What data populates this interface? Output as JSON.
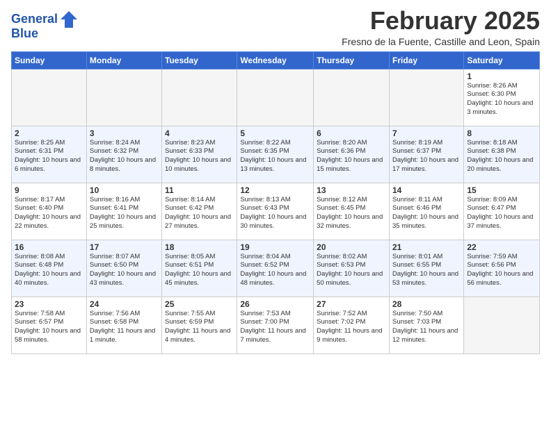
{
  "header": {
    "logo_line1": "General",
    "logo_line2": "Blue",
    "month": "February 2025",
    "location": "Fresno de la Fuente, Castille and Leon, Spain"
  },
  "weekdays": [
    "Sunday",
    "Monday",
    "Tuesday",
    "Wednesday",
    "Thursday",
    "Friday",
    "Saturday"
  ],
  "weeks": [
    [
      {
        "day": "",
        "info": ""
      },
      {
        "day": "",
        "info": ""
      },
      {
        "day": "",
        "info": ""
      },
      {
        "day": "",
        "info": ""
      },
      {
        "day": "",
        "info": ""
      },
      {
        "day": "",
        "info": ""
      },
      {
        "day": "1",
        "info": "Sunrise: 8:26 AM\nSunset: 6:30 PM\nDaylight: 10 hours\nand 3 minutes."
      }
    ],
    [
      {
        "day": "2",
        "info": "Sunrise: 8:25 AM\nSunset: 6:31 PM\nDaylight: 10 hours\nand 6 minutes."
      },
      {
        "day": "3",
        "info": "Sunrise: 8:24 AM\nSunset: 6:32 PM\nDaylight: 10 hours\nand 8 minutes."
      },
      {
        "day": "4",
        "info": "Sunrise: 8:23 AM\nSunset: 6:33 PM\nDaylight: 10 hours\nand 10 minutes."
      },
      {
        "day": "5",
        "info": "Sunrise: 8:22 AM\nSunset: 6:35 PM\nDaylight: 10 hours\nand 13 minutes."
      },
      {
        "day": "6",
        "info": "Sunrise: 8:20 AM\nSunset: 6:36 PM\nDaylight: 10 hours\nand 15 minutes."
      },
      {
        "day": "7",
        "info": "Sunrise: 8:19 AM\nSunset: 6:37 PM\nDaylight: 10 hours\nand 17 minutes."
      },
      {
        "day": "8",
        "info": "Sunrise: 8:18 AM\nSunset: 6:38 PM\nDaylight: 10 hours\nand 20 minutes."
      }
    ],
    [
      {
        "day": "9",
        "info": "Sunrise: 8:17 AM\nSunset: 6:40 PM\nDaylight: 10 hours\nand 22 minutes."
      },
      {
        "day": "10",
        "info": "Sunrise: 8:16 AM\nSunset: 6:41 PM\nDaylight: 10 hours\nand 25 minutes."
      },
      {
        "day": "11",
        "info": "Sunrise: 8:14 AM\nSunset: 6:42 PM\nDaylight: 10 hours\nand 27 minutes."
      },
      {
        "day": "12",
        "info": "Sunrise: 8:13 AM\nSunset: 6:43 PM\nDaylight: 10 hours\nand 30 minutes."
      },
      {
        "day": "13",
        "info": "Sunrise: 8:12 AM\nSunset: 6:45 PM\nDaylight: 10 hours\nand 32 minutes."
      },
      {
        "day": "14",
        "info": "Sunrise: 8:11 AM\nSunset: 6:46 PM\nDaylight: 10 hours\nand 35 minutes."
      },
      {
        "day": "15",
        "info": "Sunrise: 8:09 AM\nSunset: 6:47 PM\nDaylight: 10 hours\nand 37 minutes."
      }
    ],
    [
      {
        "day": "16",
        "info": "Sunrise: 8:08 AM\nSunset: 6:48 PM\nDaylight: 10 hours\nand 40 minutes."
      },
      {
        "day": "17",
        "info": "Sunrise: 8:07 AM\nSunset: 6:50 PM\nDaylight: 10 hours\nand 43 minutes."
      },
      {
        "day": "18",
        "info": "Sunrise: 8:05 AM\nSunset: 6:51 PM\nDaylight: 10 hours\nand 45 minutes."
      },
      {
        "day": "19",
        "info": "Sunrise: 8:04 AM\nSunset: 6:52 PM\nDaylight: 10 hours\nand 48 minutes."
      },
      {
        "day": "20",
        "info": "Sunrise: 8:02 AM\nSunset: 6:53 PM\nDaylight: 10 hours\nand 50 minutes."
      },
      {
        "day": "21",
        "info": "Sunrise: 8:01 AM\nSunset: 6:55 PM\nDaylight: 10 hours\nand 53 minutes."
      },
      {
        "day": "22",
        "info": "Sunrise: 7:59 AM\nSunset: 6:56 PM\nDaylight: 10 hours\nand 56 minutes."
      }
    ],
    [
      {
        "day": "23",
        "info": "Sunrise: 7:58 AM\nSunset: 6:57 PM\nDaylight: 10 hours\nand 58 minutes."
      },
      {
        "day": "24",
        "info": "Sunrise: 7:56 AM\nSunset: 6:58 PM\nDaylight: 11 hours\nand 1 minute."
      },
      {
        "day": "25",
        "info": "Sunrise: 7:55 AM\nSunset: 6:59 PM\nDaylight: 11 hours\nand 4 minutes."
      },
      {
        "day": "26",
        "info": "Sunrise: 7:53 AM\nSunset: 7:00 PM\nDaylight: 11 hours\nand 7 minutes."
      },
      {
        "day": "27",
        "info": "Sunrise: 7:52 AM\nSunset: 7:02 PM\nDaylight: 11 hours\nand 9 minutes."
      },
      {
        "day": "28",
        "info": "Sunrise: 7:50 AM\nSunset: 7:03 PM\nDaylight: 11 hours\nand 12 minutes."
      },
      {
        "day": "",
        "info": ""
      }
    ]
  ]
}
